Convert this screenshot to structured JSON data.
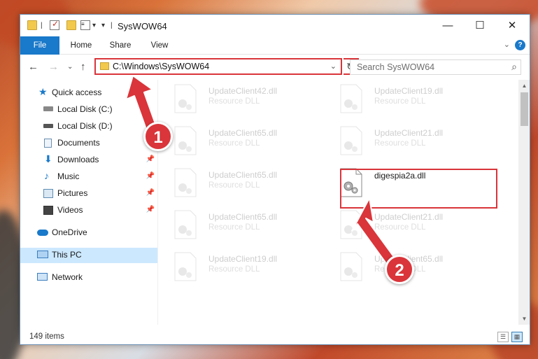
{
  "window": {
    "title": "SysWOW64",
    "controls": {
      "minimize": "—",
      "maximize": "☐",
      "close": "✕"
    }
  },
  "ribbon": {
    "tabs": [
      {
        "label": "File"
      },
      {
        "label": "Home"
      },
      {
        "label": "Share"
      },
      {
        "label": "View"
      }
    ]
  },
  "navigation": {
    "address_path": "C:\\Windows\\SysWOW64",
    "search_placeholder": "Search SysWOW64"
  },
  "sidebar": {
    "items": [
      {
        "label": "Quick access",
        "icon": "star-icon"
      },
      {
        "label": "Local Disk (C:)",
        "icon": "drive-icon"
      },
      {
        "label": "Local Disk (D:)",
        "icon": "drive-icon"
      },
      {
        "label": "Documents",
        "icon": "documents-icon",
        "pinned": true
      },
      {
        "label": "Downloads",
        "icon": "download-icon",
        "pinned": true
      },
      {
        "label": "Music",
        "icon": "music-icon",
        "pinned": true
      },
      {
        "label": "Pictures",
        "icon": "pictures-icon",
        "pinned": true
      },
      {
        "label": "Videos",
        "icon": "videos-icon",
        "pinned": true
      },
      {
        "label": "OneDrive",
        "icon": "cloud-icon"
      },
      {
        "label": "This PC",
        "icon": "computer-icon",
        "selected": true
      },
      {
        "label": "Network",
        "icon": "network-icon"
      }
    ]
  },
  "files": [
    {
      "name": "UpdateClient42.dll",
      "type": "Resource DLL"
    },
    {
      "name": "UpdateClient19.dll",
      "type": "Resource DLL"
    },
    {
      "name": "UpdateClient65.dll",
      "type": "Resource DLL"
    },
    {
      "name": "UpdateClient21.dll",
      "type": "Resource DLL"
    },
    {
      "name": "UpdateClient65.dll",
      "type": "Resource DLL"
    },
    {
      "name": "digespia2a.dll",
      "type": ""
    },
    {
      "name": "UpdateClient65.dll",
      "type": "Resource DLL"
    },
    {
      "name": "UpdateClient21.dll",
      "type": "Resource DLL"
    },
    {
      "name": "UpdateClient19.dll",
      "type": "Resource DLL"
    },
    {
      "name": "UpdateClient65.dll",
      "type": "Resource DLL"
    }
  ],
  "status": {
    "item_count": "149 items"
  },
  "annotations": {
    "step1": "1",
    "step2": "2"
  },
  "colors": {
    "accent": "#1979ca",
    "highlight": "#d9353a",
    "selected": "#cce8ff"
  }
}
